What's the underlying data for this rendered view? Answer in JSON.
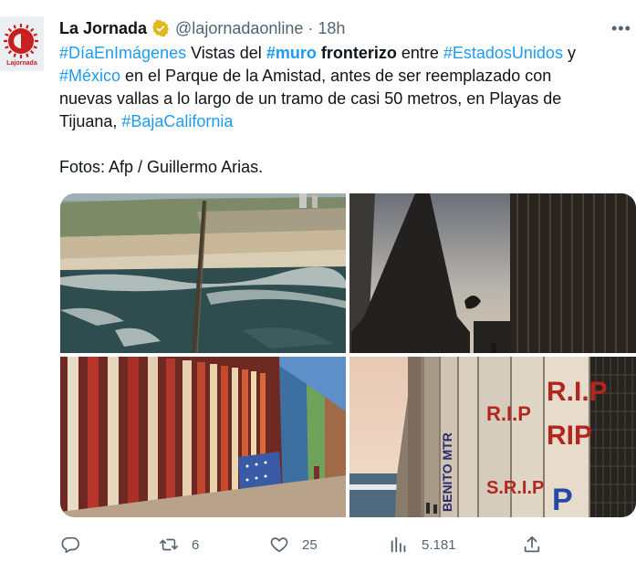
{
  "tweet": {
    "author_name": "La Jornada",
    "handle": "@lajornadaonline",
    "separator": "·",
    "time": "18h",
    "avatar_caption": "Lajornada",
    "text": {
      "line1": [
        {
          "t": "#DíaEnImágenes",
          "tag": true
        },
        {
          "t": " Vistas del ",
          "tag": false
        },
        {
          "t": "#muro",
          "tag": true,
          "bold": true
        },
        {
          "t": " fronterizo",
          "tag": false,
          "bold": true
        },
        {
          "t": " entre ",
          "tag": false
        },
        {
          "t": "#EstadosUnidos",
          "tag": true
        },
        {
          "t": " y",
          "tag": false
        }
      ],
      "line2_rest": " en el Parque de la Amistad, antes de ser reemplazado con",
      "hashtag_mexico": "#México",
      "line3": "nuevas vallas a lo largo de un tramo de casi 50 metros, en Playas de",
      "line4_prefix": "Tijuana, ",
      "hashtag_baja": "#BajaCalifornia",
      "credits": "Fotos: Afp / Guillermo Arias."
    },
    "photo_text": {
      "p4_words": [
        "R.I.P",
        "R.I.P",
        "S.R.I.P",
        "BENITO MTR",
        "RIP",
        "P"
      ]
    },
    "actions": {
      "reply_count": "",
      "retweet_count": "6",
      "like_count": "25",
      "views_count": "5.181"
    },
    "colors": {
      "accent": "#1d9bf0",
      "text": "#0f1419",
      "muted": "#536471",
      "verified_gold": "#e2b719"
    }
  }
}
